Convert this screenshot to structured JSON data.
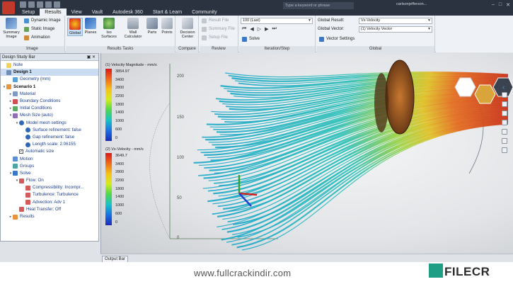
{
  "window": {
    "search_placeholder": "Type a keyword or phrase",
    "user": "carlsonjefferson..."
  },
  "tabs": [
    "Setup",
    "Results",
    "View",
    "Vault",
    "Autodesk 360",
    "Start & Learn",
    "Community"
  ],
  "active_tab": "Results",
  "ribbon": {
    "image_group": {
      "name": "Image",
      "summary_image": "Summary Image",
      "dynamic_image": "Dynamic Image",
      "static_image": "Static Image",
      "animation": "Animation"
    },
    "results_tasks": {
      "name": "Results Tasks",
      "global": "Global",
      "planes": "Planes",
      "iso_surfaces": "Iso Surfaces",
      "wall_calculator": "Wall Calculator",
      "parts": "Parts",
      "points": "Points"
    },
    "compare": {
      "name": "Compare",
      "decision_center": "Decision Center"
    },
    "review": {
      "name": "Review",
      "result_file": "Result File",
      "summary_file": "Summary File",
      "setup_file": "Setup File"
    },
    "iteration": {
      "name": "Iteration/Step",
      "step_value": "100 (Last)",
      "solve": "Solve"
    },
    "global": {
      "name": "Global",
      "global_result_label": "Global Result:",
      "global_result_value": "Vx-Velocity",
      "global_vector_label": "Global Vector:",
      "global_vector_value": "(1) Velocity Vector",
      "vector_settings": "Vector Settings"
    }
  },
  "panel": {
    "title": "Design Study Bar",
    "tree": [
      {
        "level": 0,
        "text": "Note",
        "icon": "note-icon",
        "color": "#f2d35a",
        "tw": ""
      },
      {
        "level": 0,
        "text": "Design 1",
        "icon": "design-icon",
        "color": "#6f8fb8",
        "tw": "",
        "bold": true,
        "design": true
      },
      {
        "level": 1,
        "text": "Geometry (mm)",
        "icon": "geometry-icon",
        "color": "#58a2d6",
        "tw": ""
      },
      {
        "level": 0,
        "text": "Scenario 1",
        "icon": "scenario-icon",
        "color": "#e8923a",
        "tw": "▾",
        "bold": true
      },
      {
        "level": 1,
        "text": "Material",
        "icon": "material-icon",
        "color": "#7d9bc4",
        "tw": "▸"
      },
      {
        "level": 1,
        "text": "Boundary Conditions",
        "icon": "boundary-icon",
        "color": "#d25050",
        "tw": "▸"
      },
      {
        "level": 1,
        "text": "Initial Conditions",
        "icon": "initial-icon",
        "color": "#5bab62",
        "tw": "▸"
      },
      {
        "level": 1,
        "text": "Mesh Size (auto)",
        "icon": "mesh-icon",
        "color": "#8e6fb8",
        "tw": "▾"
      },
      {
        "level": 2,
        "text": "Model mesh settings",
        "icon": "info-icon",
        "color": "#3167b5",
        "tw": "▾"
      },
      {
        "level": 3,
        "text": "Surface refinement: false",
        "icon": "info-icon",
        "color": "#3167b5",
        "tw": ""
      },
      {
        "level": 3,
        "text": "Gap refinement: false",
        "icon": "info-icon",
        "color": "#3167b5",
        "tw": ""
      },
      {
        "level": 3,
        "text": "Length scale: 2.06155",
        "icon": "info-icon",
        "color": "#3167b5",
        "tw": ""
      },
      {
        "level": 2,
        "text": "Automatic size",
        "icon": "checkbox-icon",
        "color": "",
        "tw": "",
        "check": true
      },
      {
        "level": 1,
        "text": "Motion",
        "icon": "motion-icon",
        "color": "#5b8fd6",
        "tw": ""
      },
      {
        "level": 1,
        "text": "Groups",
        "icon": "groups-icon",
        "color": "#4fa5a5",
        "tw": ""
      },
      {
        "level": 1,
        "text": "Solve",
        "icon": "solve-icon",
        "color": "#3c78c8",
        "tw": "▾"
      },
      {
        "level": 2,
        "text": "Flow: On",
        "icon": "flow-icon",
        "color": "#d45b5b",
        "tw": "▾"
      },
      {
        "level": 3,
        "text": "Compressibility: Incompr...",
        "icon": "flow-icon",
        "color": "#d45b5b",
        "tw": ""
      },
      {
        "level": 3,
        "text": "Turbulence: Turbulence",
        "icon": "flow-icon",
        "color": "#d45b5b",
        "tw": ""
      },
      {
        "level": 3,
        "text": "Advection: Adv 1",
        "icon": "flow-icon",
        "color": "#d45b5b",
        "tw": ""
      },
      {
        "level": 2,
        "text": "Heat Transfer: Off",
        "icon": "heat-icon",
        "color": "#d45b5b",
        "tw": ""
      },
      {
        "level": 1,
        "text": "Results",
        "icon": "results-icon",
        "color": "#e8923a",
        "tw": "▸"
      }
    ]
  },
  "legend1": {
    "title": "(1) Velocity Magnitude - mm/s",
    "ticks": [
      "3854.97",
      "3400",
      "2800",
      "2200",
      "1800",
      "1400",
      "1000",
      "600",
      "0"
    ]
  },
  "legend2": {
    "title": "(2) Vx-Velocity - mm/s",
    "ticks": [
      "3649.7",
      "3400",
      "2800",
      "2200",
      "1800",
      "1400",
      "1000",
      "600",
      "0"
    ]
  },
  "ruler": [
    "200",
    "150",
    "100",
    "50",
    "0"
  ],
  "output_bar": "Output Bar",
  "watermark": {
    "url": "www.fullcrackindir.com",
    "logo": "FILECR"
  }
}
